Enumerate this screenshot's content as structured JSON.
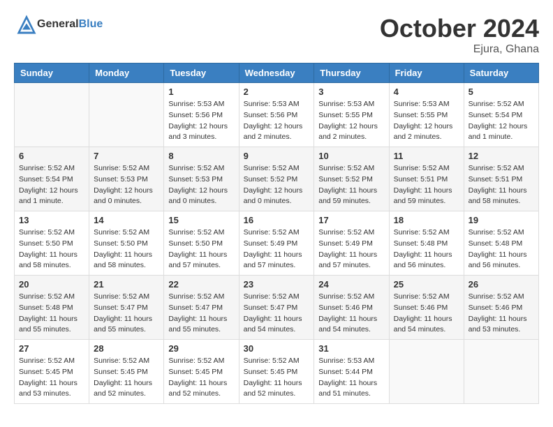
{
  "header": {
    "logo_general": "General",
    "logo_blue": "Blue",
    "month": "October 2024",
    "location": "Ejura, Ghana"
  },
  "weekdays": [
    "Sunday",
    "Monday",
    "Tuesday",
    "Wednesday",
    "Thursday",
    "Friday",
    "Saturday"
  ],
  "weeks": [
    [
      {
        "day": "",
        "sunrise": "",
        "sunset": "",
        "daylight": ""
      },
      {
        "day": "",
        "sunrise": "",
        "sunset": "",
        "daylight": ""
      },
      {
        "day": "1",
        "sunrise": "Sunrise: 5:53 AM",
        "sunset": "Sunset: 5:56 PM",
        "daylight": "Daylight: 12 hours and 3 minutes."
      },
      {
        "day": "2",
        "sunrise": "Sunrise: 5:53 AM",
        "sunset": "Sunset: 5:56 PM",
        "daylight": "Daylight: 12 hours and 2 minutes."
      },
      {
        "day": "3",
        "sunrise": "Sunrise: 5:53 AM",
        "sunset": "Sunset: 5:55 PM",
        "daylight": "Daylight: 12 hours and 2 minutes."
      },
      {
        "day": "4",
        "sunrise": "Sunrise: 5:53 AM",
        "sunset": "Sunset: 5:55 PM",
        "daylight": "Daylight: 12 hours and 2 minutes."
      },
      {
        "day": "5",
        "sunrise": "Sunrise: 5:52 AM",
        "sunset": "Sunset: 5:54 PM",
        "daylight": "Daylight: 12 hours and 1 minute."
      }
    ],
    [
      {
        "day": "6",
        "sunrise": "Sunrise: 5:52 AM",
        "sunset": "Sunset: 5:54 PM",
        "daylight": "Daylight: 12 hours and 1 minute."
      },
      {
        "day": "7",
        "sunrise": "Sunrise: 5:52 AM",
        "sunset": "Sunset: 5:53 PM",
        "daylight": "Daylight: 12 hours and 0 minutes."
      },
      {
        "day": "8",
        "sunrise": "Sunrise: 5:52 AM",
        "sunset": "Sunset: 5:53 PM",
        "daylight": "Daylight: 12 hours and 0 minutes."
      },
      {
        "day": "9",
        "sunrise": "Sunrise: 5:52 AM",
        "sunset": "Sunset: 5:52 PM",
        "daylight": "Daylight: 12 hours and 0 minutes."
      },
      {
        "day": "10",
        "sunrise": "Sunrise: 5:52 AM",
        "sunset": "Sunset: 5:52 PM",
        "daylight": "Daylight: 11 hours and 59 minutes."
      },
      {
        "day": "11",
        "sunrise": "Sunrise: 5:52 AM",
        "sunset": "Sunset: 5:51 PM",
        "daylight": "Daylight: 11 hours and 59 minutes."
      },
      {
        "day": "12",
        "sunrise": "Sunrise: 5:52 AM",
        "sunset": "Sunset: 5:51 PM",
        "daylight": "Daylight: 11 hours and 58 minutes."
      }
    ],
    [
      {
        "day": "13",
        "sunrise": "Sunrise: 5:52 AM",
        "sunset": "Sunset: 5:50 PM",
        "daylight": "Daylight: 11 hours and 58 minutes."
      },
      {
        "day": "14",
        "sunrise": "Sunrise: 5:52 AM",
        "sunset": "Sunset: 5:50 PM",
        "daylight": "Daylight: 11 hours and 58 minutes."
      },
      {
        "day": "15",
        "sunrise": "Sunrise: 5:52 AM",
        "sunset": "Sunset: 5:50 PM",
        "daylight": "Daylight: 11 hours and 57 minutes."
      },
      {
        "day": "16",
        "sunrise": "Sunrise: 5:52 AM",
        "sunset": "Sunset: 5:49 PM",
        "daylight": "Daylight: 11 hours and 57 minutes."
      },
      {
        "day": "17",
        "sunrise": "Sunrise: 5:52 AM",
        "sunset": "Sunset: 5:49 PM",
        "daylight": "Daylight: 11 hours and 57 minutes."
      },
      {
        "day": "18",
        "sunrise": "Sunrise: 5:52 AM",
        "sunset": "Sunset: 5:48 PM",
        "daylight": "Daylight: 11 hours and 56 minutes."
      },
      {
        "day": "19",
        "sunrise": "Sunrise: 5:52 AM",
        "sunset": "Sunset: 5:48 PM",
        "daylight": "Daylight: 11 hours and 56 minutes."
      }
    ],
    [
      {
        "day": "20",
        "sunrise": "Sunrise: 5:52 AM",
        "sunset": "Sunset: 5:48 PM",
        "daylight": "Daylight: 11 hours and 55 minutes."
      },
      {
        "day": "21",
        "sunrise": "Sunrise: 5:52 AM",
        "sunset": "Sunset: 5:47 PM",
        "daylight": "Daylight: 11 hours and 55 minutes."
      },
      {
        "day": "22",
        "sunrise": "Sunrise: 5:52 AM",
        "sunset": "Sunset: 5:47 PM",
        "daylight": "Daylight: 11 hours and 55 minutes."
      },
      {
        "day": "23",
        "sunrise": "Sunrise: 5:52 AM",
        "sunset": "Sunset: 5:47 PM",
        "daylight": "Daylight: 11 hours and 54 minutes."
      },
      {
        "day": "24",
        "sunrise": "Sunrise: 5:52 AM",
        "sunset": "Sunset: 5:46 PM",
        "daylight": "Daylight: 11 hours and 54 minutes."
      },
      {
        "day": "25",
        "sunrise": "Sunrise: 5:52 AM",
        "sunset": "Sunset: 5:46 PM",
        "daylight": "Daylight: 11 hours and 54 minutes."
      },
      {
        "day": "26",
        "sunrise": "Sunrise: 5:52 AM",
        "sunset": "Sunset: 5:46 PM",
        "daylight": "Daylight: 11 hours and 53 minutes."
      }
    ],
    [
      {
        "day": "27",
        "sunrise": "Sunrise: 5:52 AM",
        "sunset": "Sunset: 5:45 PM",
        "daylight": "Daylight: 11 hours and 53 minutes."
      },
      {
        "day": "28",
        "sunrise": "Sunrise: 5:52 AM",
        "sunset": "Sunset: 5:45 PM",
        "daylight": "Daylight: 11 hours and 52 minutes."
      },
      {
        "day": "29",
        "sunrise": "Sunrise: 5:52 AM",
        "sunset": "Sunset: 5:45 PM",
        "daylight": "Daylight: 11 hours and 52 minutes."
      },
      {
        "day": "30",
        "sunrise": "Sunrise: 5:52 AM",
        "sunset": "Sunset: 5:45 PM",
        "daylight": "Daylight: 11 hours and 52 minutes."
      },
      {
        "day": "31",
        "sunrise": "Sunrise: 5:53 AM",
        "sunset": "Sunset: 5:44 PM",
        "daylight": "Daylight: 11 hours and 51 minutes."
      },
      {
        "day": "",
        "sunrise": "",
        "sunset": "",
        "daylight": ""
      },
      {
        "day": "",
        "sunrise": "",
        "sunset": "",
        "daylight": ""
      }
    ]
  ]
}
